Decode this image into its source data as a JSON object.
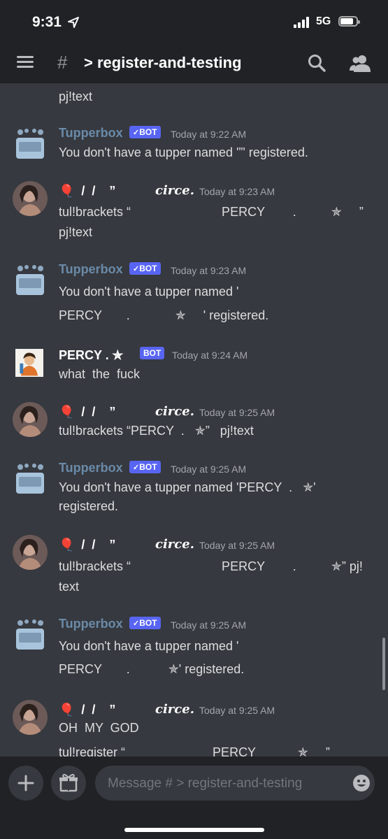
{
  "status_bar": {
    "time": "9:31",
    "network": "5G",
    "location_icon": "location-arrow-icon"
  },
  "header": {
    "hash": "#",
    "channel": "> register-and-testing"
  },
  "bot_label": "BOT",
  "messages": [
    {
      "lines": [
        "pj!text"
      ]
    },
    {
      "author": "Tupperbox",
      "bot": true,
      "time": "Today at 9:22 AM",
      "lines": [
        "You don't have a tupper named '”' registered."
      ]
    },
    {
      "author_prefix": "🎈  /  /    ”",
      "author": "circe.",
      "time": "Today at 9:23 AM",
      "lines": [
        "tul!brackets “                          PERCY        .          ✯     ”",
        "pj!text"
      ]
    },
    {
      "author": "Tupperbox",
      "bot": true,
      "time": "Today at 9:23 AM",
      "lines": [
        "You don't have a tupper named '",
        "PERCY       .             ✯     ' registered."
      ]
    },
    {
      "author": "PERCY .  ✯",
      "bot": true,
      "time": "Today at 9:24 AM",
      "lines": [
        "what  the  fuck"
      ]
    },
    {
      "author_prefix": "🎈  /  /    ”",
      "author": "circe.",
      "time": "Today at 9:25 AM",
      "lines": [
        "tul!brackets “PERCY  .   ✯”   pj!text"
      ]
    },
    {
      "author": "Tupperbox",
      "bot": true,
      "time": "Today at 9:25 AM",
      "lines": [
        "You don't have a tupper named 'PERCY  .   ✯'",
        "registered."
      ]
    },
    {
      "author_prefix": "🎈  /  /    ”",
      "author": "circe.",
      "time": "Today at 9:25 AM",
      "lines": [
        "tul!brackets “                          PERCY        .          ✯” pj!",
        "text"
      ]
    },
    {
      "author": "Tupperbox",
      "bot": true,
      "time": "Today at 9:25 AM",
      "lines": [
        "You don't have a tupper named '",
        "PERCY       .           ✯' registered."
      ]
    },
    {
      "author_prefix": "🎈  /  /    ”",
      "author": "circe.",
      "time": "Today at 9:25 AM",
      "lines": [
        "OH  MY  GOD",
        "tul!register “                         PERCY            ✯     ”"
      ]
    }
  ],
  "composer": {
    "placeholder": "Message # > register-and-testing"
  },
  "colors": {
    "bot_badge": "#5865f2",
    "tupper_name": "#6a8aa8",
    "background": "#36393f",
    "bars": "#202225"
  }
}
